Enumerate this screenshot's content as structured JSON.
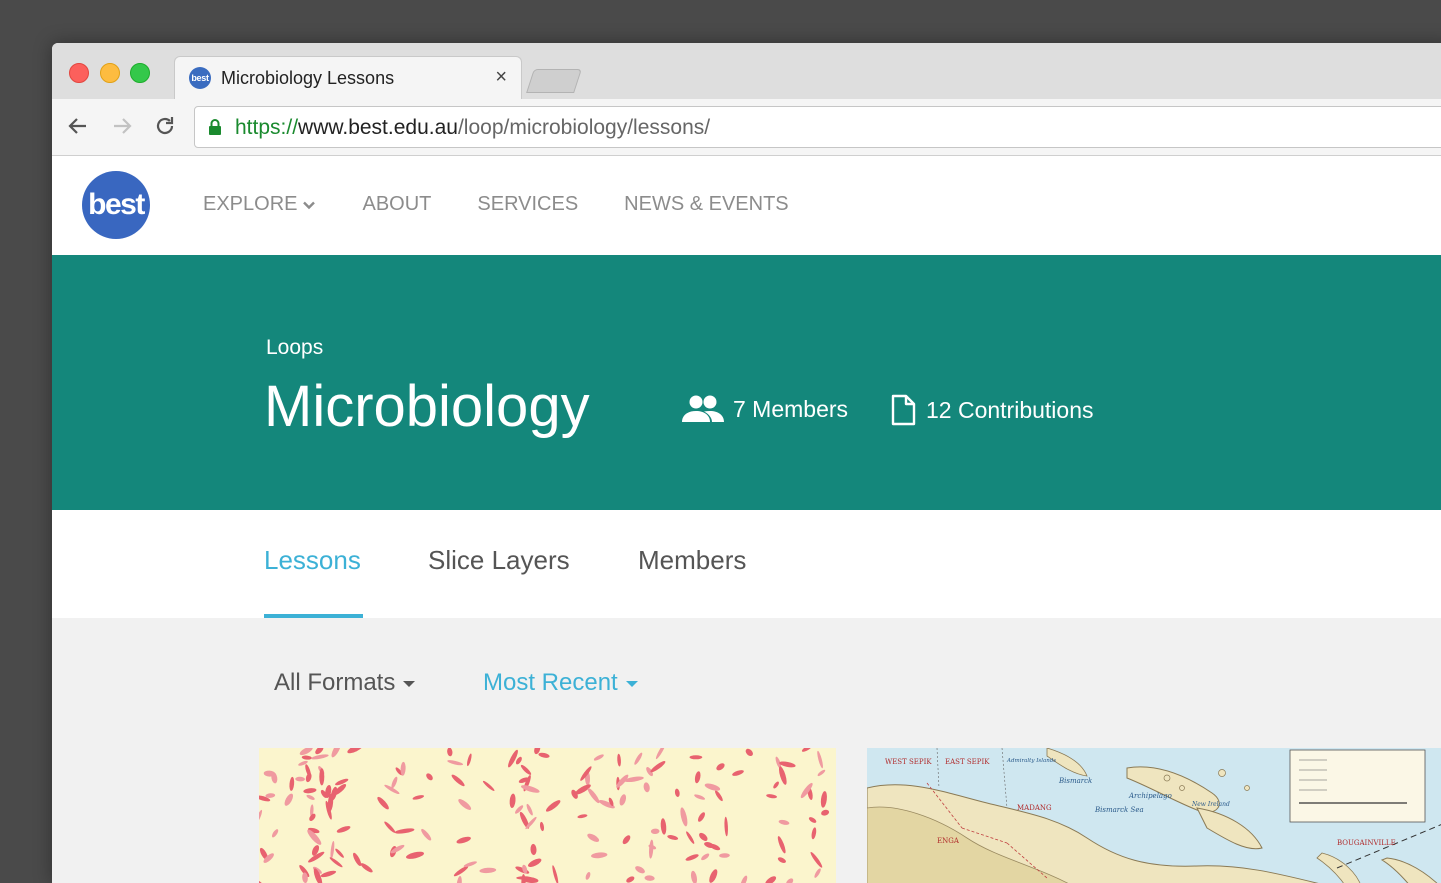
{
  "browser": {
    "tab_title": "Microbiology Lessons",
    "tab_favicon_text": "best",
    "tab_close": "×",
    "url_scheme": "https://",
    "url_host": "www.best.edu.au",
    "url_path": "/loop/microbiology/lessons/"
  },
  "site": {
    "logo_text": "best",
    "nav": [
      {
        "label": "EXPLORE"
      },
      {
        "label": "ABOUT"
      },
      {
        "label": "SERVICES"
      },
      {
        "label": "NEWS & EVENTS"
      }
    ]
  },
  "hero": {
    "breadcrumb": "Loops",
    "title": "Microbiology",
    "members": "7 Members",
    "contributions": "12 Contributions"
  },
  "tabs": [
    {
      "label": "Lessons",
      "active": true
    },
    {
      "label": "Slice Layers",
      "active": false
    },
    {
      "label": "Members",
      "active": false
    }
  ],
  "filters": {
    "format": "All Formats",
    "sort": "Most Recent"
  },
  "map_labels": {
    "l1": "WEST SEPIK",
    "l2": "EAST SEPIK",
    "l3": "MADANG",
    "l4": "Bismarck Sea",
    "l5": "Bismarck",
    "l6": "Archipelago",
    "l7": "BOUGAINVILLE",
    "l8": "New Ireland",
    "l9": "ENGA",
    "l10": "Admiralty Islands"
  },
  "colors": {
    "hero": "#14877b",
    "accent": "#3cb1d6",
    "logo": "#3967c0"
  }
}
